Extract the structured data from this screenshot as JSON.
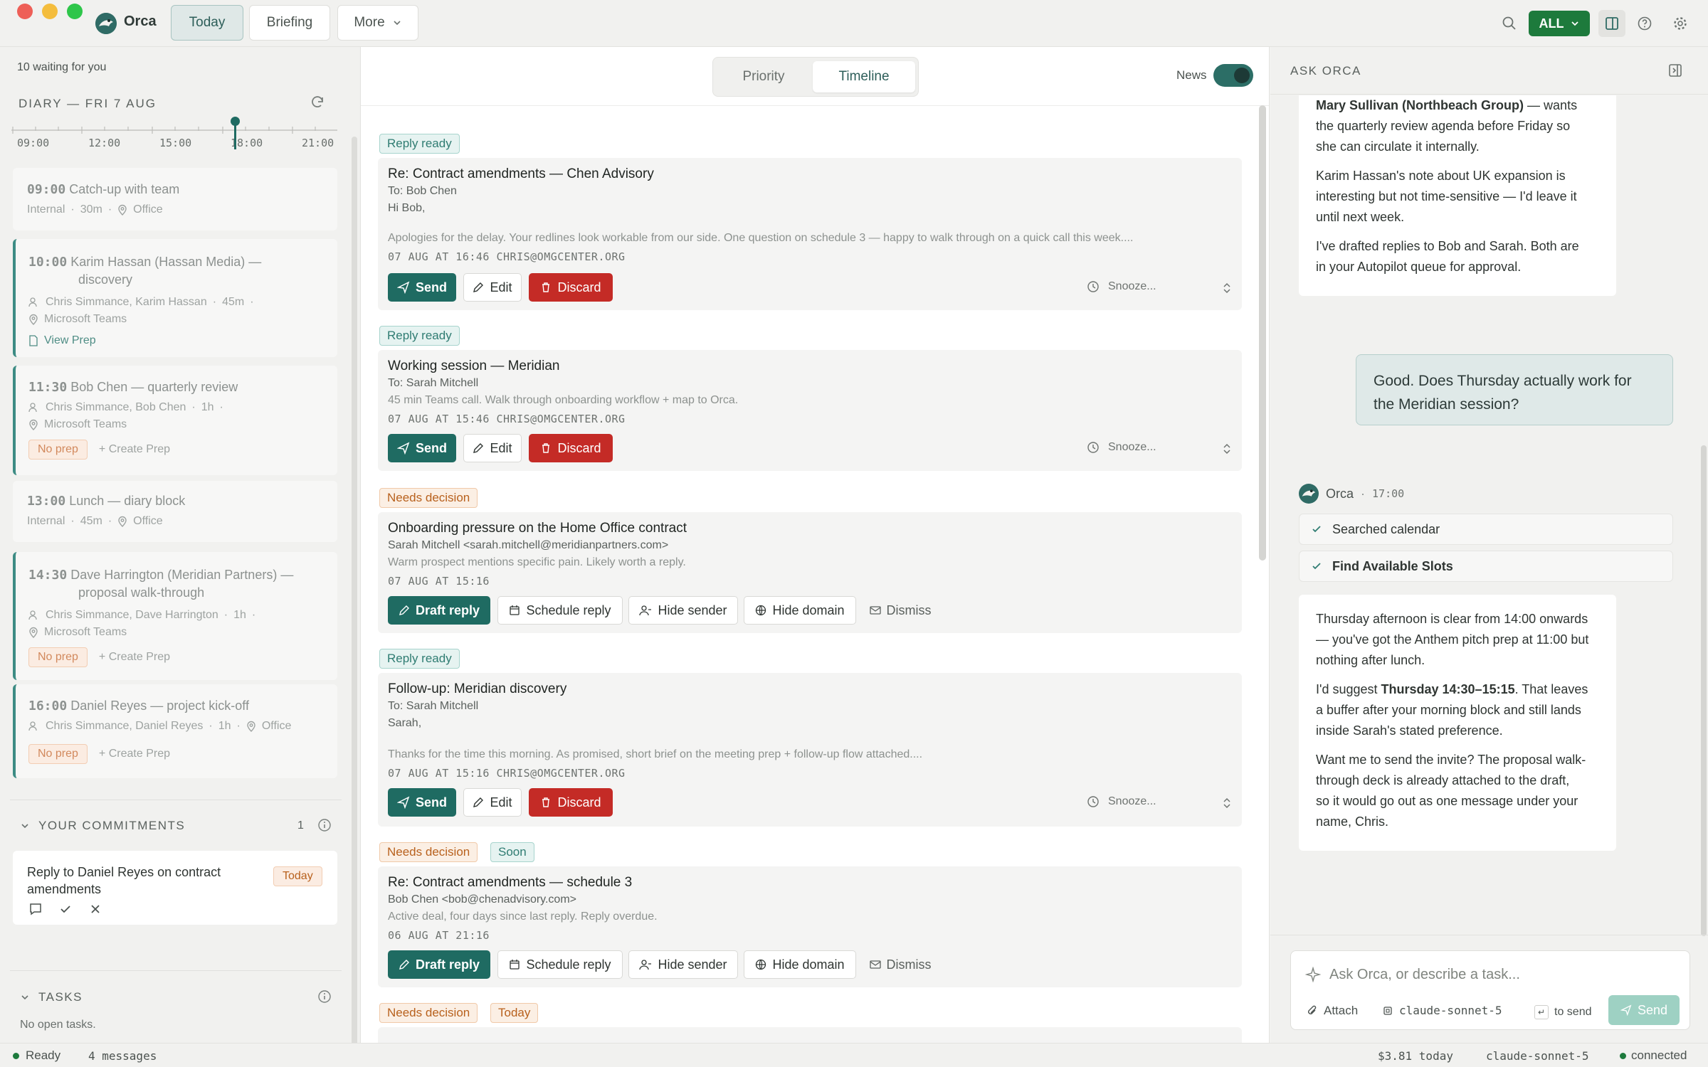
{
  "app": {
    "name": "Orca"
  },
  "nav": {
    "today": "Today",
    "briefing": "Briefing",
    "more": "More"
  },
  "topbar": {
    "filter": "ALL"
  },
  "left": {
    "waiting": "10 waiting for you",
    "diary_title": "DIARY — FRI 7 AUG",
    "ticks": [
      "09:00",
      "12:00",
      "15:00",
      "18:00",
      "21:00"
    ],
    "events": [
      {
        "time": "09:00",
        "title": "Catch-up with team",
        "meta1": "Internal",
        "meta2": "30m",
        "meta3": "Office"
      },
      {
        "time": "10:00",
        "title_line1": "Karim Hassan (Hassan Media) —",
        "title_line2": "discovery",
        "people": "Chris Simmance, Karim Hassan",
        "dur": "45m",
        "location": "Microsoft Teams",
        "link": "View Prep"
      },
      {
        "time": "11:30",
        "title": "Bob Chen — quarterly review",
        "people": "Chris Simmance, Bob Chen",
        "dur": "1h",
        "location": "Microsoft Teams",
        "noprep": "No prep",
        "create": "Create Prep"
      },
      {
        "time": "13:00",
        "title": "Lunch — diary block",
        "meta1": "Internal",
        "meta2": "45m",
        "meta3": "Office"
      },
      {
        "time": "14:30",
        "title_line1": "Dave Harrington (Meridian Partners) —",
        "title_line2": "proposal walk-through",
        "people": "Chris Simmance, Dave Harrington",
        "dur": "1h",
        "location": "Microsoft Teams",
        "noprep": "No prep",
        "create": "Create Prep"
      },
      {
        "time": "16:00",
        "title": "Daniel Reyes — project kick-off",
        "people": "Chris Simmance, Daniel Reyes",
        "dur": "1h",
        "location": "Office",
        "noprep": "No prep",
        "create": "Create Prep"
      }
    ],
    "commitments_title": "YOUR COMMITMENTS",
    "commitments_count": "1",
    "commitment": {
      "text_line1": "Reply to Daniel Reyes on contract",
      "text_line2": "amendments",
      "badge": "Today"
    },
    "tasks_title": "TASKS",
    "tasks_empty": "No open tasks."
  },
  "center": {
    "tabs": {
      "priority": "Priority",
      "timeline": "Timeline"
    },
    "news": "News",
    "items": [
      {
        "tag": "Reply ready",
        "subject": "Re: Contract amendments — Chen Advisory",
        "to": "To: Bob Chen",
        "greet": "Hi Bob,",
        "preview": "Apologies for the delay. Your redlines look workable from our side. One question on schedule 3 — happy to walk through on a quick call this week....",
        "meta": "07 AUG AT 16:46 CHRIS@OMGCENTER.ORG"
      },
      {
        "tag": "Reply ready",
        "subject": "Working session — Meridian",
        "to": "To: Sarah Mitchell",
        "preview": "45 min Teams call. Walk through onboarding workflow + map to Orca.",
        "meta": "07 AUG AT 15:46 CHRIS@OMGCENTER.ORG"
      },
      {
        "tag": "Needs decision",
        "subject": "Onboarding pressure on the Home Office contract",
        "from": "Sarah Mitchell <sarah.mitchell@meridianpartners.com>",
        "preview": "Warm prospect mentions specific pain. Likely worth a reply.",
        "meta": "07 AUG AT 15:16"
      },
      {
        "tag": "Reply ready",
        "subject": "Follow-up: Meridian discovery",
        "to": "To: Sarah Mitchell",
        "greet": "Sarah,",
        "preview": "Thanks for the time this morning. As promised, short brief on the meeting prep + follow-up flow attached....",
        "meta": "07 AUG AT 15:16 CHRIS@OMGCENTER.ORG"
      },
      {
        "tag": "Needs decision",
        "tag2": "Soon",
        "subject": "Re: Contract amendments — schedule 3",
        "from": "Bob Chen <bob@chenadvisory.com>",
        "preview": "Active deal, four days since last reply. Reply overdue.",
        "meta": "06 AUG AT 21:16"
      },
      {
        "tag": "Needs decision",
        "tag2": "Today"
      }
    ],
    "actions": {
      "send": "Send",
      "edit": "Edit",
      "discard": "Discard",
      "snooze": "Snooze...",
      "draft": "Draft reply",
      "schedule": "Schedule reply",
      "hide_sender": "Hide sender",
      "hide_domain": "Hide domain",
      "dismiss": "Dismiss"
    }
  },
  "right": {
    "title": "ASK ORCA",
    "msg1": {
      "p1_bold": "Mary Sullivan (Northbeach Group)",
      "p1_rest_a": " — wants",
      "p1_l2": "the quarterly review agenda before Friday so",
      "p1_l3": "she can circulate it internally.",
      "p2_l1": "Karim Hassan's note about UK expansion is",
      "p2_l2": "interesting but not time-sensitive — I'd leave it",
      "p2_l3": "until next week.",
      "p3_l1": "I've drafted replies to Bob and Sarah. Both are",
      "p3_l2": "in your Autopilot queue for approval."
    },
    "user_msg": "Good. Does Thursday actually work for the Meridian session?",
    "orca_name": "Orca",
    "orca_time": "17:00",
    "tools": [
      "Searched calendar",
      "Find Available Slots"
    ],
    "msg2": {
      "p1_l1": "Thursday afternoon is clear from 14:00 onwards",
      "p1_l2": "— you've got the Anthem pitch prep at 11:00 but",
      "p1_l3": "nothing after lunch.",
      "p2_a": "I'd suggest ",
      "p2_bold": "Thursday 14:30–15:15",
      "p2_b": ". That leaves",
      "p2_l2": "a buffer after your morning block and still lands",
      "p2_l3": "inside Sarah's stated preference.",
      "p3_l1": "Want me to send the invite? The proposal walk-",
      "p3_l2": "through deck is already attached to the draft,",
      "p3_l3": "so it would go out as one message under your",
      "p3_l4": "name, Chris."
    },
    "input_placeholder": "Ask Orca, or describe a task...",
    "attach": "Attach",
    "model": "claude-sonnet-5",
    "to_send": "to send",
    "send": "Send"
  },
  "status": {
    "ready": "Ready",
    "messages": "4 messages",
    "cost": "$3.81 today",
    "model": "claude-sonnet-5",
    "connected": "connected"
  },
  "colors": {
    "accent": "#1f6b62",
    "discard": "#c42b26",
    "all_button": "#1d7a3c"
  }
}
